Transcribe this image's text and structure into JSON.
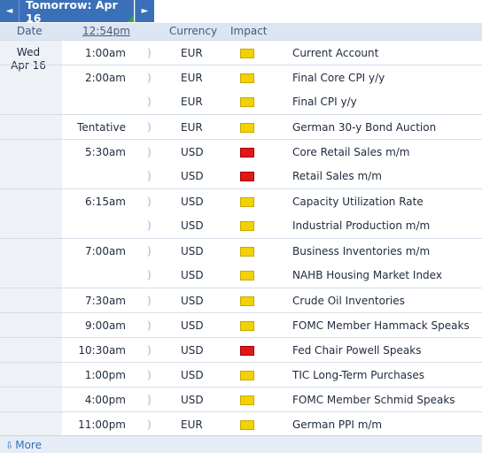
{
  "header": {
    "title": "Tomorrow: Apr 16",
    "prev_icon": "◄",
    "next_icon": "►"
  },
  "columns": {
    "date": "Date",
    "time": "12:54pm",
    "currency": "Currency",
    "impact": "Impact"
  },
  "date": {
    "weekday": "Wed",
    "day": "Apr 16"
  },
  "events": [
    {
      "time": "1:00am",
      "currency": "EUR",
      "impact": "low",
      "event": "Current Account"
    },
    {
      "time": "2:00am",
      "currency": "EUR",
      "impact": "low",
      "event": "Final Core CPI y/y"
    },
    {
      "time": "",
      "currency": "EUR",
      "impact": "low",
      "event": "Final CPI y/y"
    },
    {
      "time": "Tentative",
      "currency": "EUR",
      "impact": "low",
      "event": "German 30-y Bond Auction"
    },
    {
      "time": "5:30am",
      "currency": "USD",
      "impact": "high",
      "event": "Core Retail Sales m/m"
    },
    {
      "time": "",
      "currency": "USD",
      "impact": "high",
      "event": "Retail Sales m/m"
    },
    {
      "time": "6:15am",
      "currency": "USD",
      "impact": "low",
      "event": "Capacity Utilization Rate"
    },
    {
      "time": "",
      "currency": "USD",
      "impact": "low",
      "event": "Industrial Production m/m"
    },
    {
      "time": "7:00am",
      "currency": "USD",
      "impact": "low",
      "event": "Business Inventories m/m"
    },
    {
      "time": "",
      "currency": "USD",
      "impact": "low",
      "event": "NAHB Housing Market Index"
    },
    {
      "time": "7:30am",
      "currency": "USD",
      "impact": "low",
      "event": "Crude Oil Inventories"
    },
    {
      "time": "9:00am",
      "currency": "USD",
      "impact": "low",
      "event": "FOMC Member Hammack Speaks"
    },
    {
      "time": "10:30am",
      "currency": "USD",
      "impact": "high",
      "event": "Fed Chair Powell Speaks"
    },
    {
      "time": "1:00pm",
      "currency": "USD",
      "impact": "low",
      "event": "TIC Long-Term Purchases"
    },
    {
      "time": "4:00pm",
      "currency": "USD",
      "impact": "low",
      "event": "FOMC Member Schmid Speaks"
    },
    {
      "time": "11:00pm",
      "currency": "EUR",
      "impact": "low",
      "event": "German PPI m/m"
    }
  ],
  "footer": {
    "more_icon": "⇩",
    "more_label": "More"
  },
  "colors": {
    "accent": "#3a70b8",
    "impact_low": "#f2d200",
    "impact_high": "#e01818"
  }
}
